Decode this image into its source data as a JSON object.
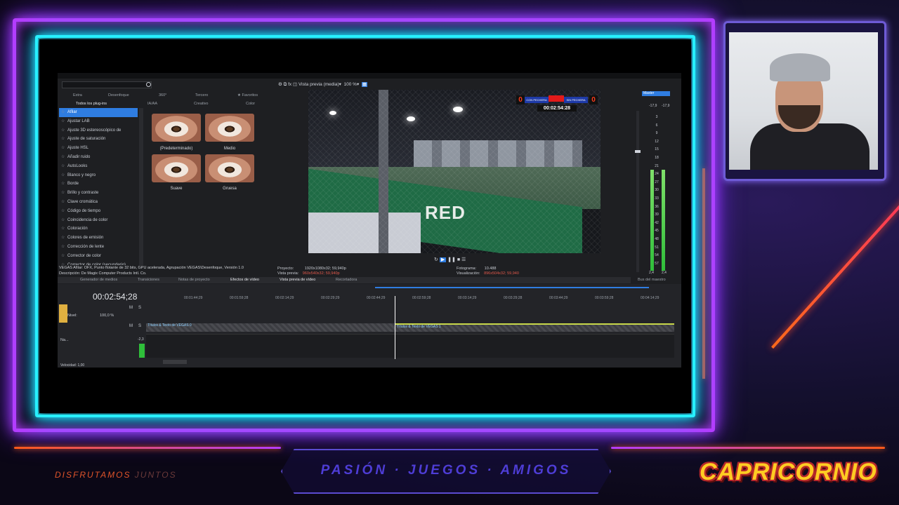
{
  "overlay": {
    "banner_text": "PASIÓN · JUEGOS · AMIGOS",
    "left_tag_a": "DISFRUTAMOS",
    "left_tag_b": "JUNTOS",
    "logo": "CAPRICORNIO",
    "accent": "#b43cff",
    "cyan": "#27f0ff"
  },
  "plugins": {
    "search_placeholder": "",
    "tabs_row1": [
      "Extra",
      "Desenfoque",
      "360°",
      "Tercero",
      "Favoritos"
    ],
    "tabs_row2": [
      "Todos los plug-ins",
      "IA/AA",
      "Creativo",
      "Color"
    ],
    "items": [
      "Afilar",
      "Ajustar LAB",
      "Ajuste 3D estereoscópico de",
      "Ajuste de saturación",
      "Ajuste HSL",
      "Añadir ruido",
      "AutoLooks",
      "Blanco y negro",
      "Borde",
      "Brillo y contraste",
      "Clave cromática",
      "Código de tiempo",
      "Coincidencia de color",
      "Coloración",
      "Colores de emisión",
      "Corrección de lente",
      "Corrector de color",
      "Corrector de color (secundario)"
    ],
    "presets": [
      "(Predeterminado)",
      "Medio",
      "Suave",
      "Gruesa"
    ],
    "info_line1": "VEGAS Afilar: OFX, Punto flotante de 32 bits, GPU acelerada, Agrupación VEGAS\\Desenfoque, Versión 1.0",
    "info_line2": "Descripción: De Magix Computer Products Intl. Co.",
    "bottom_tabs": [
      "Generador de medios",
      "Transiciones",
      "Notas de proyecto",
      "Efectos de vídeo"
    ]
  },
  "preview": {
    "mode": "Vista previa (media)",
    "zoom": "100 %",
    "score_home": "0",
    "score_away": "0",
    "team_home": "CON PECHERA",
    "team_away": "SIN PECHERA",
    "clock": "00:02:54:28",
    "project_label": "Proyecto:",
    "project_value": "1920x1080x32; 59,940p",
    "preview_label": "Vista previa:",
    "preview_value": "960x540x32; 59,940p",
    "frame_label": "Fotograma:",
    "frame_value": "10.488",
    "display_label": "Visualización:",
    "display_value": "896x504x32; 59,940",
    "tabs": [
      "Vista previa de vídeo",
      "Recortadora"
    ]
  },
  "master": {
    "title": "Master",
    "left_db": "-17,9",
    "right_db": "-17,9",
    "scale": [
      "3",
      "6",
      "9",
      "12",
      "15",
      "18",
      "21",
      "24",
      "27",
      "30",
      "33",
      "36",
      "39",
      "42",
      "45",
      "48",
      "51",
      "54",
      "57"
    ],
    "bottom_left": "2,4",
    "bottom_right": "2,4",
    "tab": "Bus del maestro"
  },
  "timeline": {
    "timecode": "00:02:54;28",
    "ruler": [
      "00:01:44;29",
      "00:01:59;28",
      "00:02:14;29",
      "00:02:29;29",
      "00:02:44;29",
      "00:02:59;28",
      "00:03:14;29",
      "00:03:29;28",
      "00:03:44;29",
      "00:03:59;28",
      "00:04:14;29"
    ],
    "level_label": "Nivel:",
    "level_value": "100,0 %",
    "clip1": "Títulos & Texto de VEGAS 0",
    "clip2": "Títulos & Texto de VEGAS 1",
    "audio_label": "Na...",
    "audio_db": "-2,3",
    "rate": "Velocidad: 1,00"
  }
}
